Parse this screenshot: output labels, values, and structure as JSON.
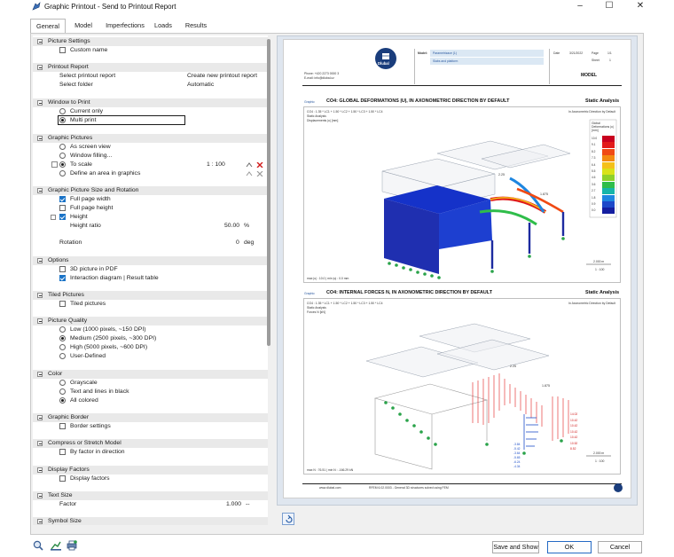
{
  "window": {
    "title": "Graphic Printout - Send to Printout Report",
    "min_symbol": "–",
    "max_symbol": "☐",
    "close_symbol": "✕"
  },
  "tabs": [
    "General",
    "Model",
    "Imperfections",
    "Loads",
    "Results"
  ],
  "tree": {
    "picture_settings": {
      "header": "Picture Settings",
      "custom_name": "Custom name"
    },
    "printout_report": {
      "header": "Printout Report",
      "select_report": "Select printout report",
      "select_report_value": "Create new printout report",
      "select_folder": "Select folder",
      "select_folder_value": "Automatic"
    },
    "window_to_print": {
      "header": "Window to Print",
      "current_only": "Current only",
      "multi_print": "Multi print"
    },
    "graphic_pictures": {
      "header": "Graphic Pictures",
      "as_screen_view": "As screen view",
      "window_filling": "Window filling...",
      "to_scale": "To scale",
      "to_scale_value": "1 : 100",
      "define_area": "Define an area in graphics"
    },
    "size_rotation": {
      "header": "Graphic Picture Size and Rotation",
      "full_width": "Full page width",
      "full_height": "Full page height",
      "height": "Height",
      "height_ratio": "Height ratio",
      "height_ratio_value": "50.00",
      "height_ratio_unit": "%",
      "rotation": "Rotation",
      "rotation_value": "0",
      "rotation_unit": "deg"
    },
    "options": {
      "header": "Options",
      "pdf_3d": "3D picture in PDF",
      "interaction": "Interaction diagram | Result table"
    },
    "tiled": {
      "header": "Tiled Pictures",
      "tiled_pictures": "Tiled pictures"
    },
    "quality": {
      "header": "Picture Quality",
      "low": "Low (1000 pixels, ~150 DPI)",
      "medium": "Medium (2500 pixels, ~300 DPI)",
      "high": "High (5000 pixels, ~600 DPI)",
      "user_defined": "User-Defined"
    },
    "color": {
      "header": "Color",
      "grayscale": "Grayscale",
      "text_black": "Text and lines in black",
      "all_colored": "All colored"
    },
    "border": {
      "header": "Graphic Border",
      "border_settings": "Border settings"
    },
    "compress": {
      "header": "Compress or Stretch Model",
      "by_factor": "By factor in direction"
    },
    "display": {
      "header": "Display Factors",
      "display_factors": "Display factors"
    },
    "text_size": {
      "header": "Text Size",
      "factor": "Factor",
      "factor_value": "1.000",
      "factor_unit": "--"
    },
    "symbol_size": {
      "header": "Symbol Size"
    }
  },
  "preview": {
    "header": {
      "phone": "Phone: +420 2273 0000 3",
      "email": "E-mail: info@dlubal.cz",
      "model_label": "Model:",
      "model_value": "Parametrizace (1)",
      "slabs": "Slabs and platform",
      "date_label": "Date",
      "date_value": "3/21/2022",
      "page_label": "Page",
      "page_value": "1/1",
      "sheet_label": "Sheet",
      "sheet_value": "1",
      "model_title": "MODEL",
      "logo_text": "Dlubal"
    },
    "section1": {
      "tag": "Graphic",
      "title": "CO4: GLOBAL DEFORMATIONS |U|, IN AXONOMETRIC DIRECTION BY DEFAULT",
      "right": "Static Analysis",
      "sub1": "CO4 : 1.35 * LC1 + 1.50 * LC2 + 1.50 * LC3 + 1.50 * LC4",
      "sub2": "Static Analysis",
      "sub3": "Displacements |u| [mm]",
      "sub_right": "In Axonometric Direction by Default",
      "legend_title": "Global Deformations |u| [mm]",
      "legend_values": [
        "10.0",
        "9.1",
        "8.2",
        "7.3",
        "6.4",
        "5.5",
        "4.6",
        "3.6",
        "2.7",
        "1.8",
        "0.9",
        "0.0"
      ],
      "legend_colors": [
        "#c8001e",
        "#e21a1a",
        "#f04a14",
        "#f38a10",
        "#f4c01a",
        "#d9e21a",
        "#8fd12a",
        "#2fbd4a",
        "#16b5a9",
        "#1e86e0",
        "#1d48c9",
        "#141ea0"
      ],
      "footer": "max |u| : 10.0 | min |u| : 0.0 mm",
      "scale_top": "2.000 m",
      "scale_bottom": "1 : 100",
      "label_a": "2.25",
      "label_b": "1.875"
    },
    "section2": {
      "tag": "Graphic",
      "title": "CO4: INTERNAL FORCES N, IN AXONOMETRIC DIRECTION BY DEFAULT",
      "right": "Static Analysis",
      "sub1": "CO4 : 1.35 * LC1 + 1.50 * LC2 + 1.50 * LC3 + 1.50 * LC4",
      "sub2": "Static Analysis",
      "sub3": "Forces N [kN]",
      "sub_right": "In Axonometric Direction by Default",
      "footer": "max N : 76.51 | min N : -166.29 kN",
      "scale_top": "2.000 m",
      "scale_bottom": "1 : 100",
      "label_a": "2.25",
      "label_b": "1.875",
      "values_red": [
        "14.02",
        "10.42",
        "10.42",
        "10.42",
        "10.42",
        "10.52",
        "8.52"
      ],
      "values_blue": [
        "-3.84",
        "-5.42",
        "-3.64",
        "-5.65",
        "-6.24",
        "-4.34"
      ]
    },
    "footer": {
      "site": "www.dlubal.com",
      "product": "RFEM 6.02.0003 - General 3D structures solved using FEM"
    }
  },
  "bottom": {
    "save_show": "Save and Show",
    "ok": "OK",
    "cancel": "Cancel"
  },
  "colors": {
    "accent": "#1a73c7",
    "primary_border": "#2369c4",
    "dlubal_blue": "#1a3d7c",
    "deform_red": "#e01b1b"
  },
  "icons": [
    "app-icon",
    "search-icon",
    "chart-arrow-icon",
    "print-icon",
    "refresh-icon",
    "pick-icon",
    "delete-icon"
  ]
}
